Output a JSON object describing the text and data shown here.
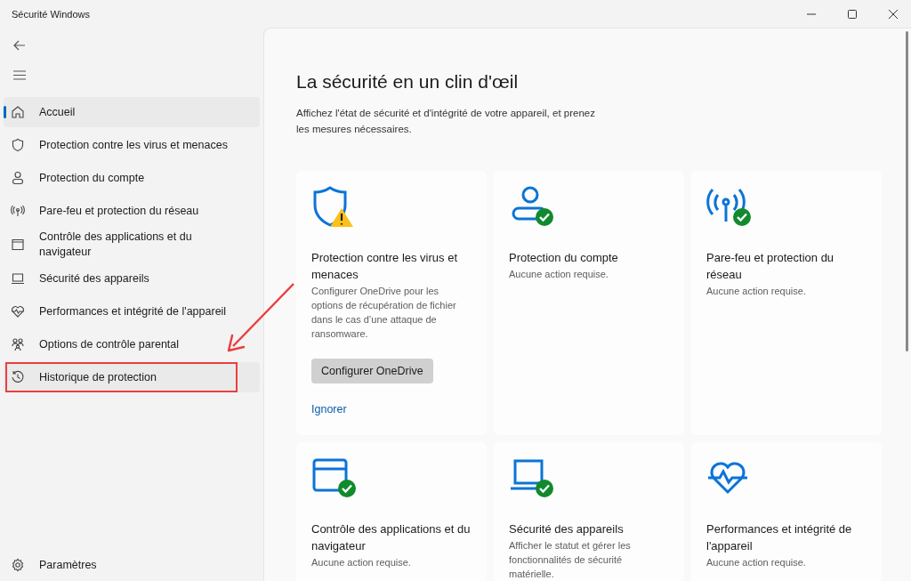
{
  "window": {
    "title": "Sécurité Windows"
  },
  "sidebar": {
    "items": [
      {
        "kind": "home",
        "label": "Accueil",
        "selected": true,
        "highlighted": false
      },
      {
        "kind": "shield",
        "label": "Protection contre les virus et menaces",
        "selected": false,
        "highlighted": false
      },
      {
        "kind": "person",
        "label": "Protection du compte",
        "selected": false,
        "highlighted": false
      },
      {
        "kind": "antenna",
        "label": "Pare-feu et protection du réseau",
        "selected": false,
        "highlighted": false
      },
      {
        "kind": "window",
        "label": "Contrôle des applications et du navigateur",
        "selected": false,
        "highlighted": false
      },
      {
        "kind": "laptop",
        "label": "Sécurité des appareils",
        "selected": false,
        "highlighted": false
      },
      {
        "kind": "heart",
        "label": "Performances et intégrité de l'appareil",
        "selected": false,
        "highlighted": false
      },
      {
        "kind": "family",
        "label": "Options de contrôle parental",
        "selected": false,
        "highlighted": false
      },
      {
        "kind": "history",
        "label": "Historique de protection",
        "selected": false,
        "highlighted": true
      }
    ],
    "settings": "Paramètres"
  },
  "main": {
    "title": "La sécurité en un clin d'œil",
    "description": "Affichez l'état de sécurité et d'intégrité de votre appareil, et prenez les mesures nécessaires.",
    "cards": [
      {
        "kind": "shield",
        "warning": true,
        "ok": false,
        "title": "Protection contre les virus et menaces",
        "text": "Configurer OneDrive pour les options de récupération de fichier dans le cas d’une attaque de ransomware.",
        "button": "Configurer OneDrive",
        "link": "Ignorer"
      },
      {
        "kind": "person",
        "warning": false,
        "ok": true,
        "title": "Protection du compte",
        "text": "Aucune action requise."
      },
      {
        "kind": "antenna",
        "warning": false,
        "ok": true,
        "title": "Pare-feu et protection du réseau",
        "text": "Aucune action requise."
      },
      {
        "kind": "window",
        "warning": false,
        "ok": true,
        "title": "Contrôle des applications et du navigateur",
        "text": "Aucune action requise."
      },
      {
        "kind": "laptop",
        "warning": false,
        "ok": true,
        "title": "Sécurité des appareils",
        "text": "Afficher le statut et gérer les fonctionnalités de sécurité matérielle."
      },
      {
        "kind": "heart",
        "warning": false,
        "ok": false,
        "title": "Performances et intégrité de l'appareil",
        "text": "Aucune action requise."
      }
    ]
  }
}
